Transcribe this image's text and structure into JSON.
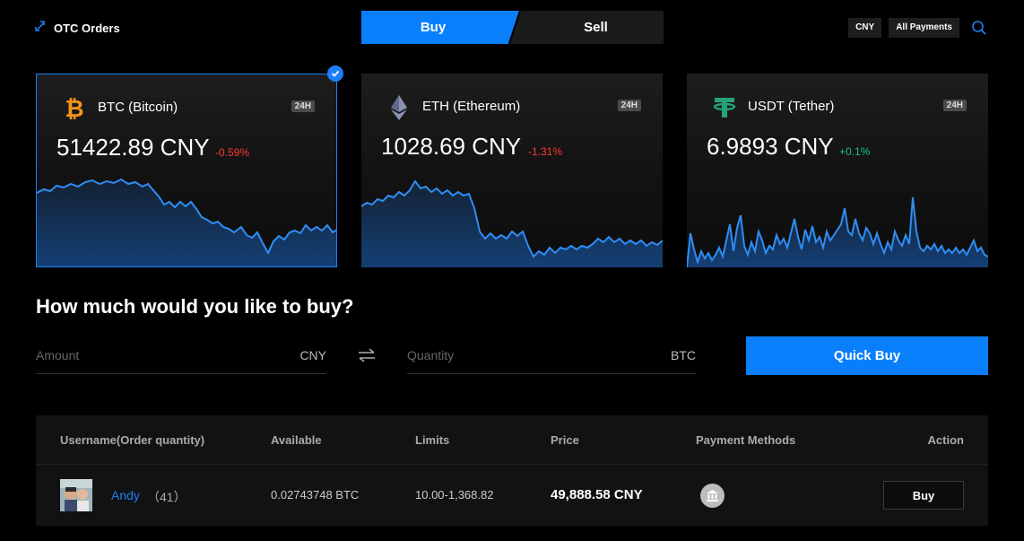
{
  "header": {
    "title": "OTC Orders",
    "tabs": {
      "buy": "Buy",
      "sell": "Sell"
    },
    "currency_chip": "CNY",
    "payments_chip": "All Payments"
  },
  "cards": [
    {
      "name": "BTC (Bitcoin)",
      "price": "51422.89 CNY",
      "change": "-0.59%",
      "period": "24H",
      "change_color": "#ff3b30",
      "selected": true
    },
    {
      "name": "ETH (Ethereum)",
      "price": "1028.69 CNY",
      "change": "-1.31%",
      "period": "24H",
      "change_color": "#ff3b30",
      "selected": false
    },
    {
      "name": "USDT (Tether)",
      "price": "6.9893 CNY",
      "change": "+0.1%",
      "period": "24H",
      "change_color": "#17c27a",
      "selected": false
    }
  ],
  "buy_form": {
    "question": "How much would you like to buy?",
    "amount_placeholder": "Amount",
    "amount_unit": "CNY",
    "quantity_placeholder": "Quantity",
    "quantity_unit": "BTC",
    "quick_buy": "Quick Buy"
  },
  "table": {
    "headers": [
      "Username(Order quantity)",
      "Available",
      "Limits",
      "Price",
      "Payment Methods",
      "Action"
    ],
    "rows": [
      {
        "username": "Andy",
        "order_count": "（41）",
        "available": "0.02743748 BTC",
        "limits": "10.00-1,368.82",
        "price": "49,888.58 CNY",
        "payment_icon": "bank-icon",
        "action": "Buy"
      }
    ]
  },
  "colors": {
    "accent": "#0a7ffb",
    "negative": "#ff3b30",
    "positive": "#17c27a",
    "chart_line": "#2f8df5"
  }
}
